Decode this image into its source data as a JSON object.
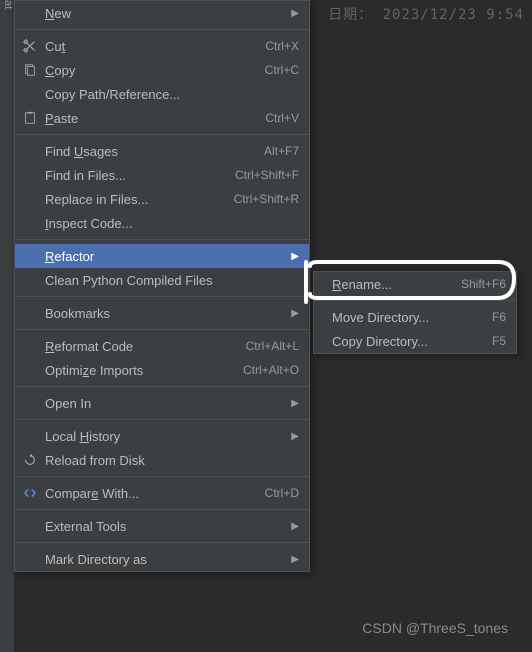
{
  "background": {
    "dateLabel": "日期：",
    "dateValue": "2023/12/23 9:54"
  },
  "mainMenu": {
    "new": "New",
    "cut": "Cut",
    "cutKey": "Ctrl+X",
    "copy": "Copy",
    "copyKey": "Ctrl+C",
    "copyPath": "Copy Path/Reference...",
    "paste": "Paste",
    "pasteKey": "Ctrl+V",
    "findUsages": "Find Usages",
    "findUsagesKey": "Alt+F7",
    "findInFiles": "Find in Files...",
    "findInFilesKey": "Ctrl+Shift+F",
    "replaceInFiles": "Replace in Files...",
    "replaceInFilesKey": "Ctrl+Shift+R",
    "inspectCode": "Inspect Code...",
    "refactor": "Refactor",
    "cleanPython": "Clean Python Compiled Files",
    "bookmarks": "Bookmarks",
    "reformatCode": "Reformat Code",
    "reformatCodeKey": "Ctrl+Alt+L",
    "optimizeImports": "Optimize Imports",
    "optimizeImportsKey": "Ctrl+Alt+O",
    "openIn": "Open In",
    "localHistory": "Local History",
    "reloadFromDisk": "Reload from Disk",
    "compareWith": "Compare With...",
    "compareWithKey": "Ctrl+D",
    "externalTools": "External Tools",
    "markDirectoryAs": "Mark Directory as"
  },
  "subMenu": {
    "rename": "Rename...",
    "renameKey": "Shift+F6",
    "moveDirectory": "Move Directory...",
    "moveDirectoryKey": "F6",
    "copyDirectory": "Copy Directory...",
    "copyDirectoryKey": "F5"
  },
  "watermark": "CSDN @ThreeS_tones"
}
